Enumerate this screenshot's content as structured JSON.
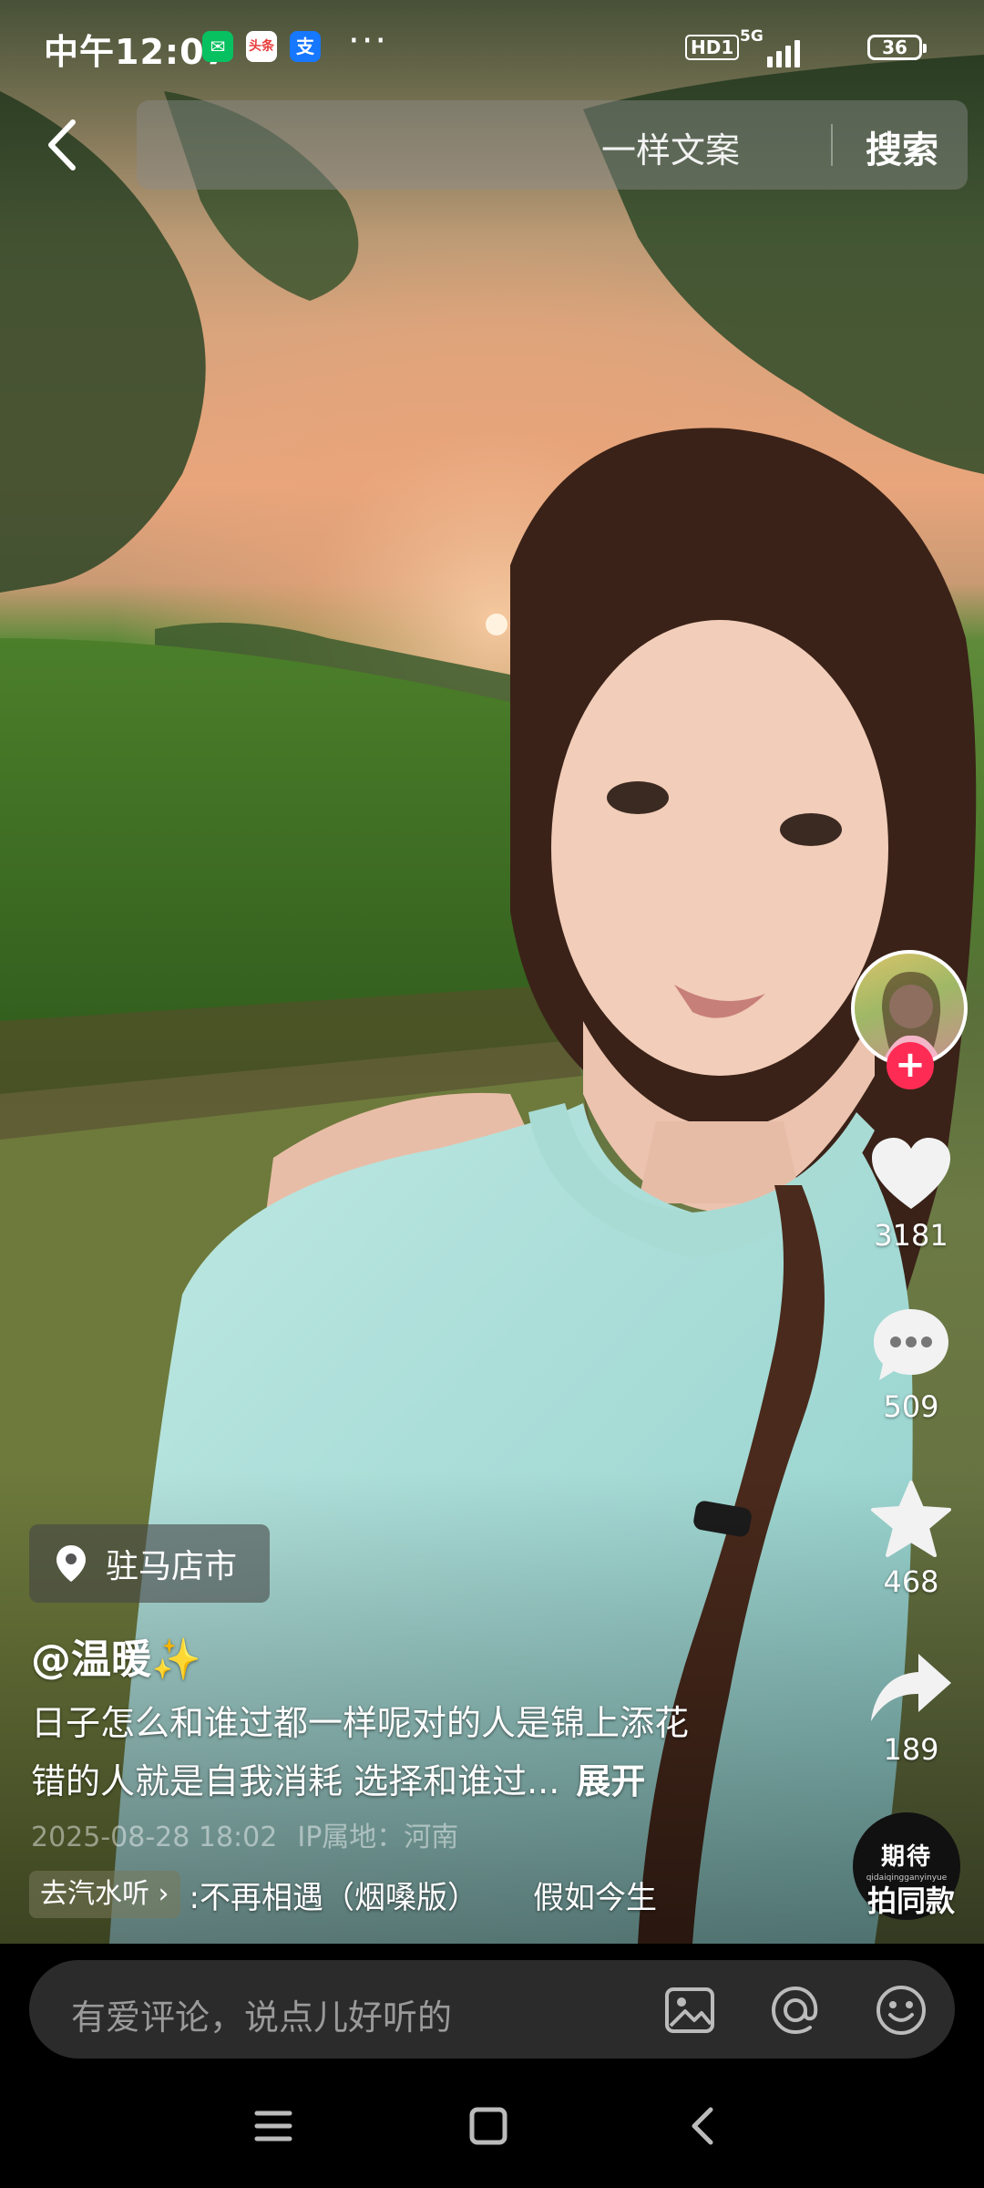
{
  "status_bar": {
    "time": "中午12:07",
    "app_icons": [
      {
        "name": "wechat-icon",
        "glyph": "✉",
        "color": "#07c160"
      },
      {
        "name": "toutiao-icon",
        "glyph": "头条",
        "color": "#e83b3b"
      },
      {
        "name": "alipay-icon",
        "glyph": "支",
        "color": "#1677ff"
      }
    ],
    "more": "···",
    "hd": "HD1",
    "network": "5G",
    "battery": "36"
  },
  "search": {
    "query": "一样文案",
    "button": "搜索"
  },
  "actions": {
    "likes": "3181",
    "comments": "509",
    "favorites": "468",
    "shares": "189",
    "shoot_badge_title": "期待",
    "shoot_badge_sub": "qidaiqingganyinyue",
    "shoot_label": "拍同款"
  },
  "post": {
    "location": "驻马店市",
    "username": "@温暖✨",
    "caption_line1": "日子怎么和谁过都一样呢对的人是锦上添花",
    "caption_line2": "错的人就是自我消耗 选择和谁过...",
    "expand": "展开",
    "date": "2025-08-28 18:02",
    "ip": "IP属地：河南",
    "music_tag": "去汽水听",
    "music_title": ":不再相遇（烟嗓版）",
    "music_title2": "假如今生"
  },
  "comment": {
    "placeholder": "有爱评论，说点儿好听的"
  },
  "colors": {
    "accent": "#fe2c55",
    "comment_bar": "#2b2b2b"
  }
}
